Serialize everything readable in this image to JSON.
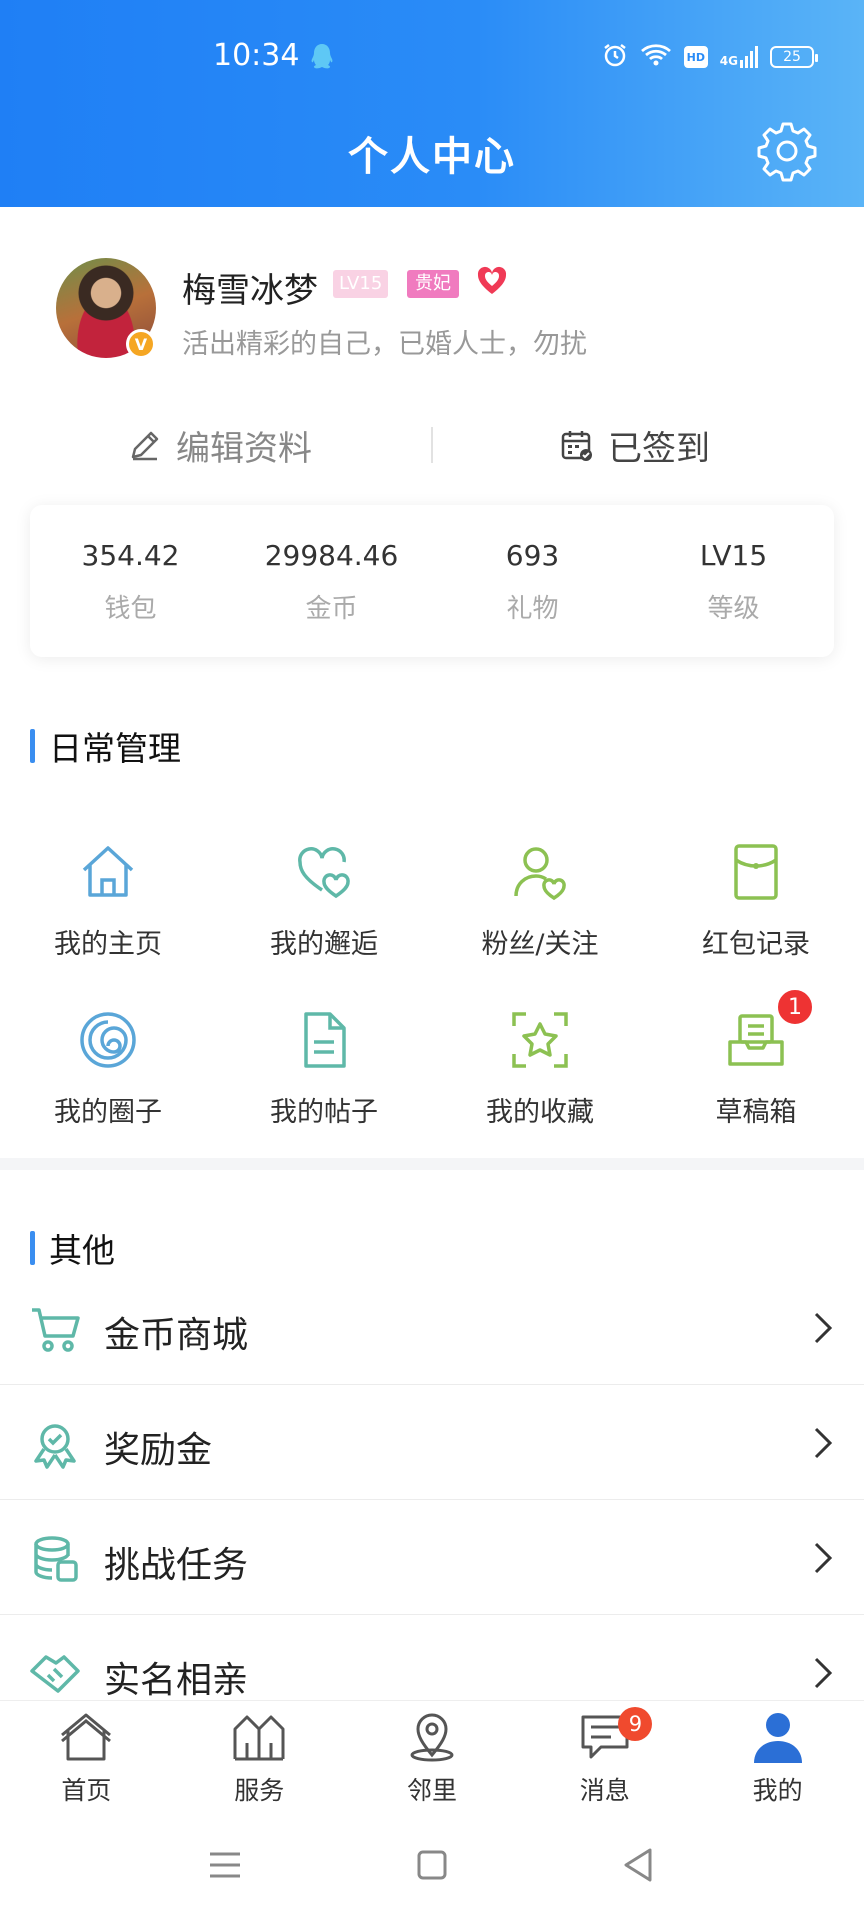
{
  "status_bar": {
    "time": "10:34",
    "hd": "HD",
    "signal": "4G",
    "battery": "25"
  },
  "header": {
    "title": "个人中心"
  },
  "profile": {
    "name": "梅雪冰梦",
    "level_badge": "LV15",
    "title_badge": "贵妃",
    "bio": "活出精彩的自己，已婚人士，勿扰",
    "verify_mark": "V"
  },
  "actions": {
    "edit": "编辑资料",
    "sign_in": "已签到"
  },
  "stats": [
    {
      "value": "354.42",
      "label": "钱包"
    },
    {
      "value": "29984.46",
      "label": "金币"
    },
    {
      "value": "693",
      "label": "礼物"
    },
    {
      "value": "LV15",
      "label": "等级"
    }
  ],
  "daily": {
    "title": "日常管理",
    "items": [
      {
        "label": "我的主页",
        "icon": "home-icon"
      },
      {
        "label": "我的邂逅",
        "icon": "hearts-icon"
      },
      {
        "label": "粉丝/关注",
        "icon": "user-heart-icon"
      },
      {
        "label": "红包记录",
        "icon": "red-envelope-icon"
      },
      {
        "label": "我的圈子",
        "icon": "circle-icon"
      },
      {
        "label": "我的帖子",
        "icon": "document-icon"
      },
      {
        "label": "我的收藏",
        "icon": "star-icon"
      },
      {
        "label": "草稿箱",
        "icon": "drafts-icon",
        "badge": "1"
      }
    ]
  },
  "other": {
    "title": "其他",
    "items": [
      {
        "label": "金币商城",
        "icon": "cart-icon"
      },
      {
        "label": "奖励金",
        "icon": "award-icon"
      },
      {
        "label": "挑战任务",
        "icon": "coins-icon"
      },
      {
        "label": "实名相亲",
        "icon": "handshake-icon"
      }
    ]
  },
  "bottom_nav": [
    {
      "label": "首页",
      "icon": "home-icon"
    },
    {
      "label": "服务",
      "icon": "service-icon"
    },
    {
      "label": "邻里",
      "icon": "location-icon"
    },
    {
      "label": "消息",
      "icon": "message-icon",
      "badge": "9"
    },
    {
      "label": "我的",
      "icon": "person-icon",
      "active": true
    }
  ],
  "colors": {
    "header_start": "#1f7ff5",
    "header_end": "#5ab4f7",
    "accent": "#3a8ef0",
    "icon_blue": "#5aa6d8",
    "icon_green": "#8cc152",
    "icon_teal": "#5fb8a8",
    "badge_red": "#ee3333"
  }
}
